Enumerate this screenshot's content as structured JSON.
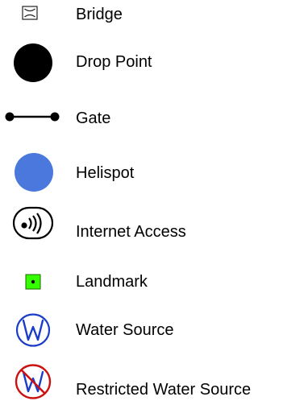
{
  "legend": {
    "items": [
      {
        "label": "Bridge",
        "icon": "bridge-icon"
      },
      {
        "label": "Drop Point",
        "icon": "drop-point-icon",
        "color": "#000000"
      },
      {
        "label": "Gate",
        "icon": "gate-icon",
        "color": "#000000"
      },
      {
        "label": "Helispot",
        "icon": "helispot-icon",
        "color": "#4a78dc"
      },
      {
        "label": "Internet Access",
        "icon": "internet-access-icon"
      },
      {
        "label": "Landmark",
        "icon": "landmark-icon",
        "color": "#33ff00"
      },
      {
        "label": "Water Source",
        "icon": "water-source-icon",
        "color": "#1a3cc8"
      },
      {
        "label": "Restricted Water Source",
        "icon": "restricted-water-source-icon",
        "color": "#cc1111"
      }
    ]
  }
}
